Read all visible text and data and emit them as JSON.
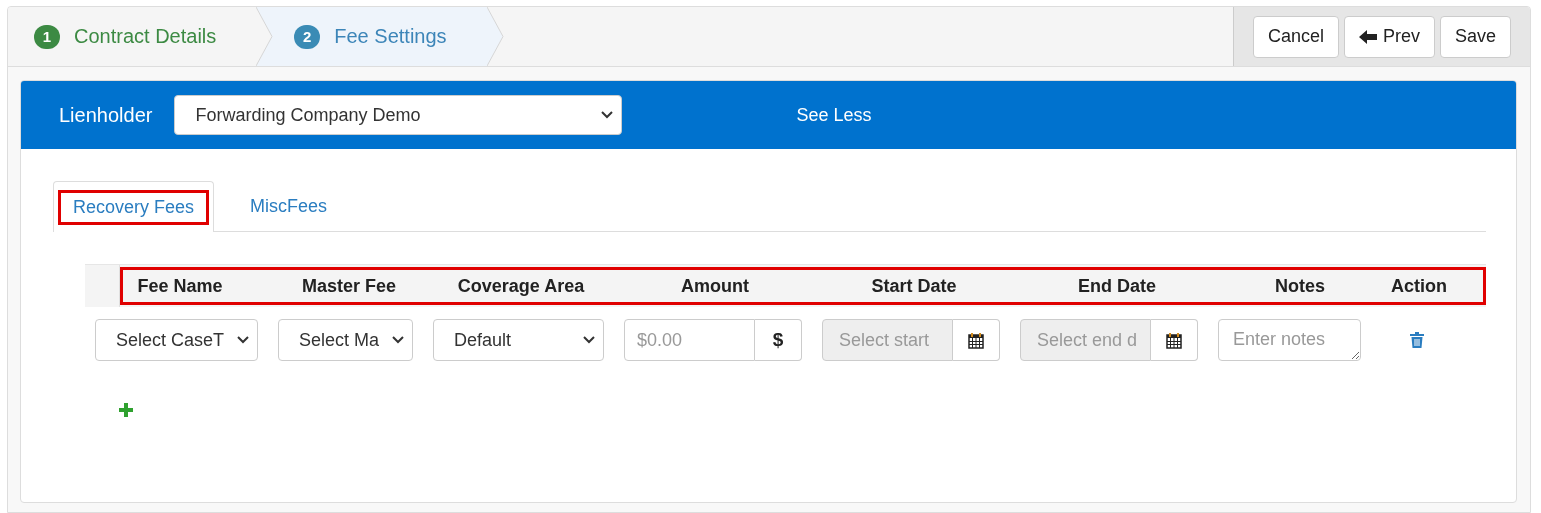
{
  "wizard": {
    "steps": [
      {
        "number": "1",
        "label": "Contract Details",
        "completed": true,
        "selected": false
      },
      {
        "number": "2",
        "label": "Fee Settings",
        "completed": false,
        "selected": true
      }
    ],
    "buttons": [
      {
        "label": "Cancel",
        "kind": "plain"
      },
      {
        "label": "Prev",
        "kind": "back"
      },
      {
        "label": "Save",
        "kind": "plain"
      }
    ]
  },
  "lienholder": {
    "label": "Lienholder",
    "value": "Forwarding Company Demo",
    "toggle": "See Less"
  },
  "tabs": [
    {
      "label": "Recovery Fees",
      "selected": true,
      "highlighted": true
    },
    {
      "label": "MiscFees",
      "selected": false,
      "highlighted": false
    }
  ],
  "table": {
    "header_highlighted": true,
    "columns": [
      "Fee Name",
      "Master Fee",
      "Coverage Area",
      "Amount",
      "Start Date",
      "End Date",
      "Notes",
      "Action"
    ],
    "rows": [
      {
        "fee_name": "Select CaseT",
        "master_fee": "Select Ma",
        "coverage_area": "Default",
        "amount": {
          "placeholder": "$0.00",
          "addon": "$"
        },
        "start_date": {
          "placeholder": "Select start",
          "readonly": true
        },
        "end_date": {
          "placeholder": "Select end d",
          "readonly": true
        },
        "notes": {
          "placeholder": "Enter notes"
        }
      }
    ]
  }
}
